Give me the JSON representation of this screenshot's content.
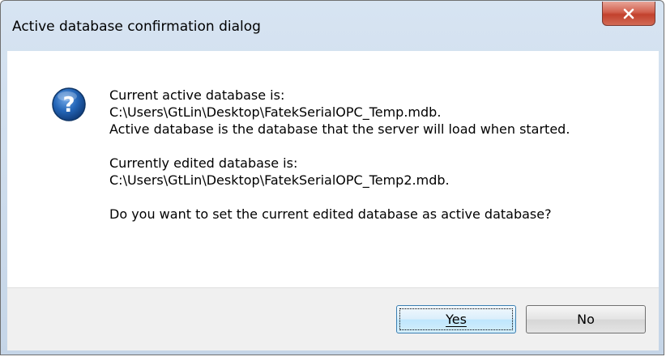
{
  "window": {
    "title": "Active database confirmation dialog"
  },
  "icons": {
    "close": "close-icon",
    "question": "question-icon"
  },
  "message": {
    "line1": "Current active database is:",
    "line2": "C:\\Users\\GtLin\\Desktop\\FatekSerialOPC_Temp.mdb.",
    "line3": "Active database is the database that the server will load when started.",
    "line4": "Currently edited database is:",
    "line5": "C:\\Users\\GtLin\\Desktop\\FatekSerialOPC_Temp2.mdb.",
    "line6": "Do you want to set the current edited database as active database?"
  },
  "buttons": {
    "yes_label": "Yes",
    "no_label": "No"
  },
  "colors": {
    "close_button": "#c2412d",
    "question_icon": "#1e5fa8",
    "default_button_border": "#3c7fb1"
  }
}
